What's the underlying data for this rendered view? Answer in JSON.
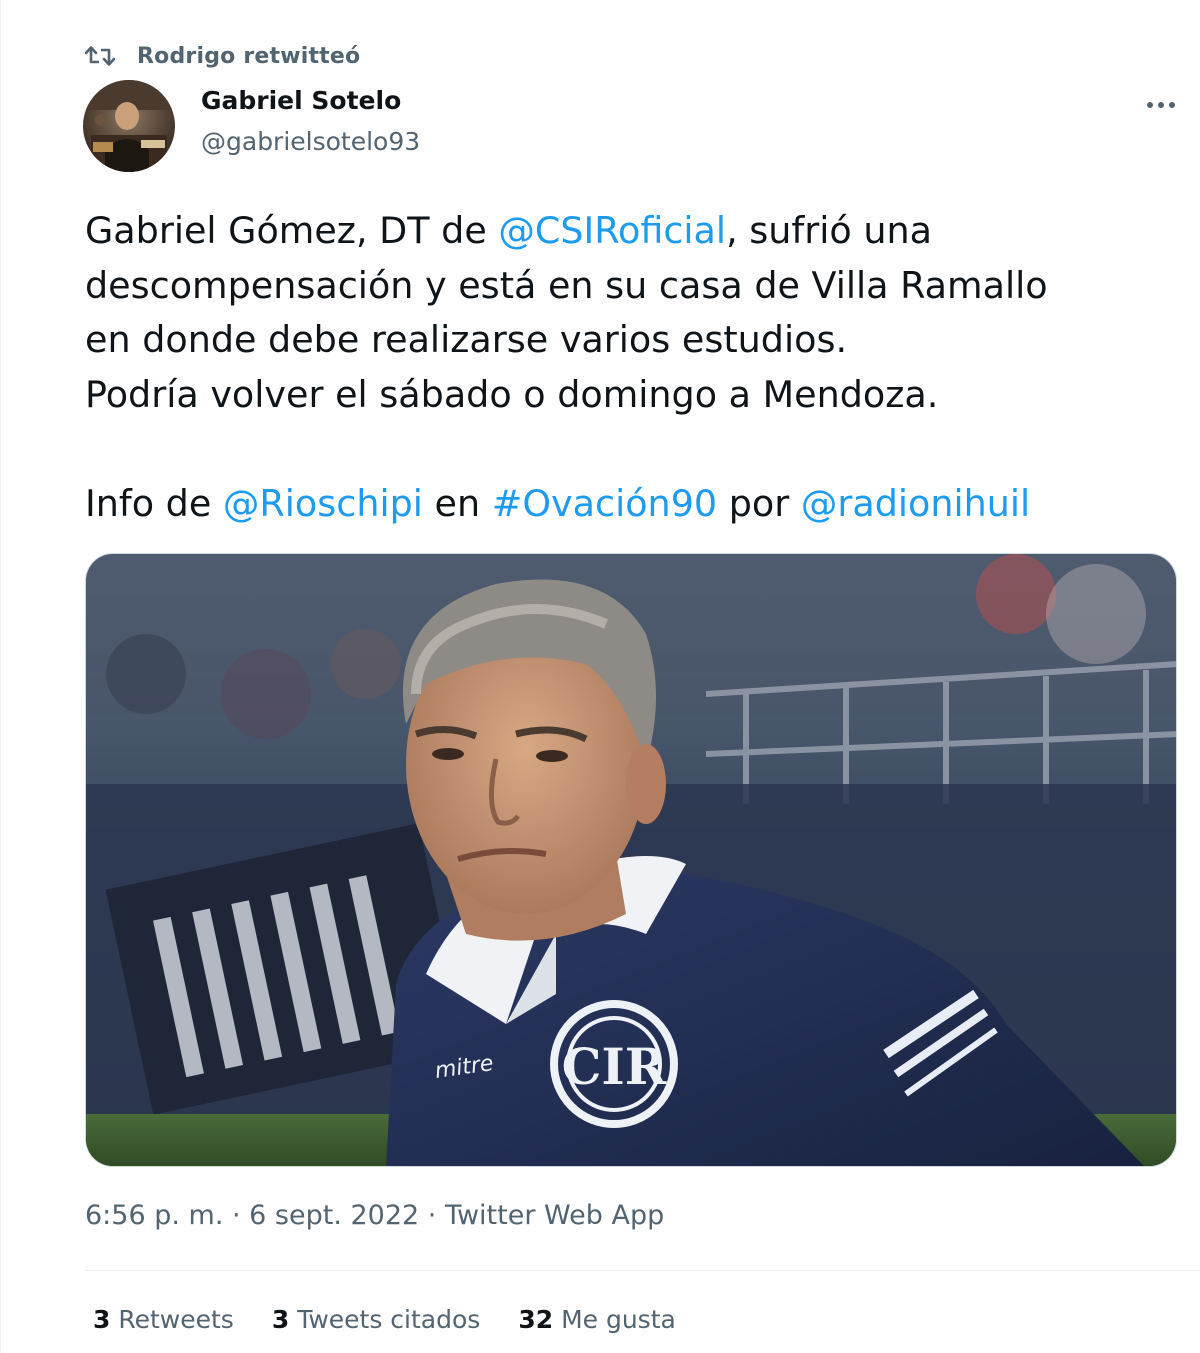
{
  "retweet": {
    "label": "Rodrigo retwitteó",
    "icon": "retweet-icon"
  },
  "author": {
    "name": "Gabriel Sotelo",
    "handle": "@gabrielsotelo93"
  },
  "menu": {
    "icon": "more-icon"
  },
  "text": {
    "l1_pre": "Gabriel Gómez, DT de ",
    "l1_mention": "@CSIRoficial",
    "l1_post": ", sufrió una",
    "l2": "descompensación y está en su casa de Villa Ramallo",
    "l3": "en donde debe realizarse varios estudios.",
    "l4": "Podría volver el sábado o domingo a Mendoza.",
    "l5_pre": "Info de ",
    "l5_mention1": "@Rioschipi",
    "l5_mid1": " en ",
    "l5_hashtag": "#Ovación90",
    "l5_mid2": " por ",
    "l5_mention2": "@radionihuil"
  },
  "media": {
    "jersey_brand": "mitre",
    "crest_letters": "CIR"
  },
  "meta": {
    "time": "6:56 p. m.",
    "sep1": " · ",
    "date": "6 sept. 2022",
    "sep2": " · ",
    "source": "Twitter Web App"
  },
  "stats": {
    "retweets_count": "3",
    "retweets_label": "Retweets",
    "quotes_count": "3",
    "quotes_label": "Tweets citados",
    "likes_count": "32",
    "likes_label": "Me gusta"
  },
  "colors": {
    "link": "#1d9bf0",
    "secondary": "#536471",
    "primary": "#0f1419"
  }
}
